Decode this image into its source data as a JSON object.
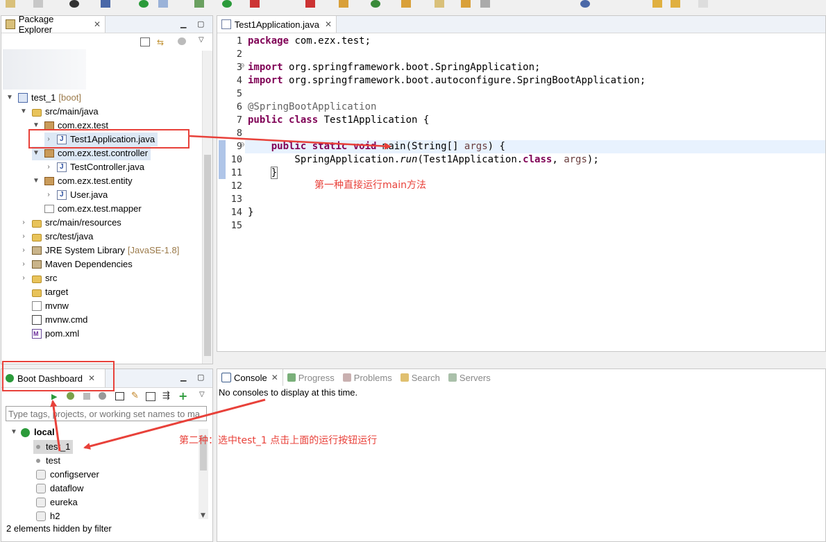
{
  "package_explorer": {
    "tab_label": "Package Explorer",
    "items": [
      {
        "label": "test_1",
        "suffix": "[boot]"
      },
      {
        "label": "src/main/java"
      },
      {
        "label": "com.ezx.test"
      },
      {
        "label": "Test1Application.java"
      },
      {
        "label": "com.ezx.test.controller"
      },
      {
        "label": "TestController.java"
      },
      {
        "label": "com.ezx.test.entity"
      },
      {
        "label": "User.java"
      },
      {
        "label": "com.ezx.test.mapper"
      },
      {
        "label": "src/main/resources"
      },
      {
        "label": "src/test/java"
      },
      {
        "label": "JRE System Library",
        "suffix": "[JavaSE-1.8]"
      },
      {
        "label": "Maven Dependencies"
      },
      {
        "label": "src"
      },
      {
        "label": "target"
      },
      {
        "label": "mvnw"
      },
      {
        "label": "mvnw.cmd"
      },
      {
        "label": "pom.xml"
      }
    ]
  },
  "editor": {
    "tab_label": "Test1Application.java",
    "line_numbers": [
      "1",
      "2",
      "3",
      "4",
      "5",
      "6",
      "7",
      "8",
      "9",
      "10",
      "11",
      "12",
      "13",
      "14",
      "15"
    ]
  },
  "annotations": {
    "first": "第一种直接运行main方法",
    "second": "第二种：选中test_1 点击上面的运行按钮运行"
  },
  "boot_dashboard": {
    "tab_label": "Boot Dashboard",
    "filter_placeholder": "Type tags, projects, or working set names to ma",
    "group": "local",
    "items": [
      "test_1",
      "test",
      "configserver",
      "dataflow",
      "eureka",
      "h2"
    ],
    "status": "2 elements hidden by filter"
  },
  "console": {
    "tabs": [
      "Console",
      "Progress",
      "Problems",
      "Search",
      "Servers"
    ],
    "message": "No consoles to display at this time."
  },
  "colors": {
    "annotation_red": "#e8413a",
    "keyword": "#7f0055",
    "selection": "#dde8f5"
  }
}
